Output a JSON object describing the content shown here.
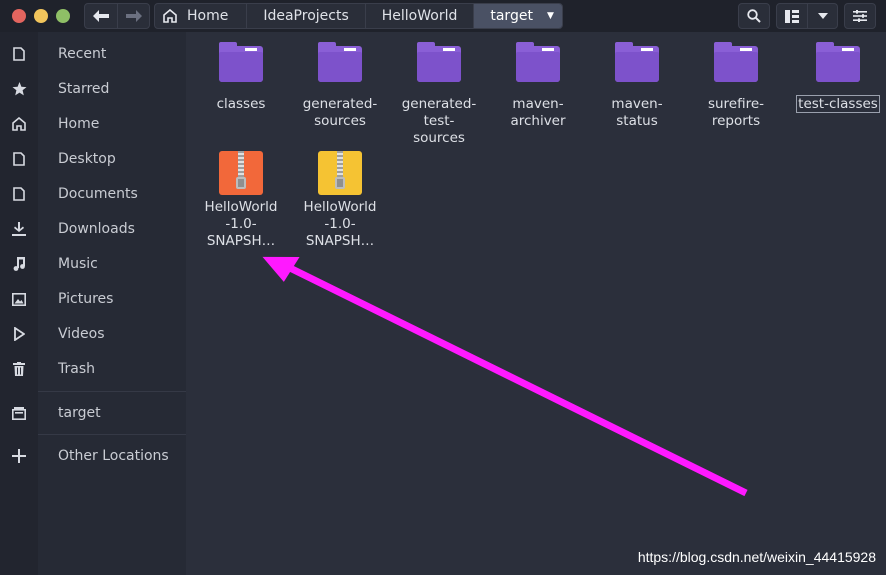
{
  "header": {
    "breadcrumbs": [
      "Home",
      "IdeaProjects",
      "HelloWorld",
      "target"
    ],
    "active_crumb": "target",
    "nav": {
      "back_icon": "arrow-left-icon",
      "forward_icon": "arrow-right-icon"
    },
    "tools": [
      "search-icon",
      "view-list-icon",
      "chevron-down-icon",
      "settings-icon"
    ]
  },
  "sidebar": {
    "items": [
      {
        "label": "Recent",
        "icon": "recent-icon"
      },
      {
        "label": "Starred",
        "icon": "star-icon"
      },
      {
        "label": "Home",
        "icon": "home-icon"
      },
      {
        "label": "Desktop",
        "icon": "desktop-icon"
      },
      {
        "label": "Documents",
        "icon": "documents-icon"
      },
      {
        "label": "Downloads",
        "icon": "download-icon"
      },
      {
        "label": "Music",
        "icon": "music-icon"
      },
      {
        "label": "Pictures",
        "icon": "pictures-icon"
      },
      {
        "label": "Videos",
        "icon": "videos-icon"
      },
      {
        "label": "Trash",
        "icon": "trash-icon"
      }
    ],
    "mounted": {
      "label": "target",
      "icon": "drive-icon"
    },
    "other": {
      "label": "Other Locations",
      "icon": "plus-icon"
    }
  },
  "files": {
    "folders": [
      {
        "lines": [
          "classes"
        ]
      },
      {
        "lines": [
          "generated-",
          "sources"
        ]
      },
      {
        "lines": [
          "generated-",
          "test-",
          "sources"
        ]
      },
      {
        "lines": [
          "maven-",
          "archiver"
        ]
      },
      {
        "lines": [
          "maven-",
          "status"
        ]
      },
      {
        "lines": [
          "surefire-",
          "reports"
        ]
      },
      {
        "lines": [
          "test-classes"
        ]
      }
    ],
    "archives": [
      {
        "lines": [
          "HelloWorld",
          "-1.0-",
          "SNAPSH…"
        ],
        "color": "#f2683a"
      },
      {
        "lines": [
          "HelloWorld",
          "-1.0-",
          "SNAPSH…"
        ],
        "color": "#f5c333"
      }
    ]
  },
  "colors": {
    "annotation_arrow": "#ff19ff",
    "folder": "#8a5fd6"
  },
  "watermark": "https://blog.csdn.net/weixin_44415928"
}
